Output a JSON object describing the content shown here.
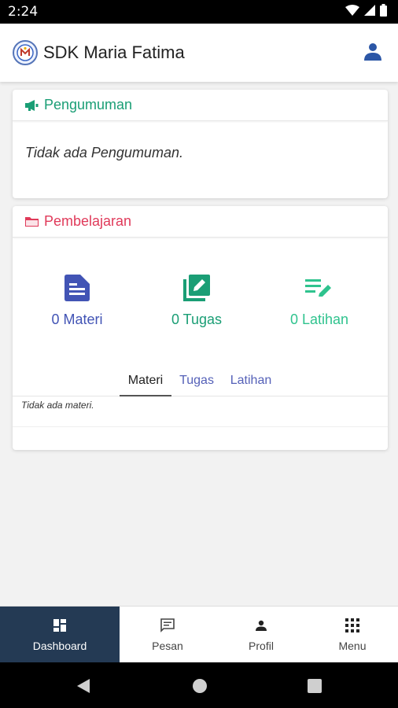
{
  "status_bar": {
    "time": "2:24"
  },
  "app_bar": {
    "title": "SDK Maria Fatima"
  },
  "announcement": {
    "title": "Pengumuman",
    "empty_text": "Tidak ada Pengumuman.",
    "accent": "#1a9e75"
  },
  "learning": {
    "title": "Pembelajaran",
    "accent": "#e03a5a",
    "stats": [
      {
        "label": "0 Materi",
        "icon": "document-icon",
        "color": "#4254b5"
      },
      {
        "label": "0 Tugas",
        "icon": "edit-box-icon",
        "color": "#1a9e75"
      },
      {
        "label": "0 Latihan",
        "icon": "list-edit-icon",
        "color": "#2fc38e"
      }
    ],
    "tabs": [
      {
        "label": "Materi",
        "active": true
      },
      {
        "label": "Tugas",
        "active": false
      },
      {
        "label": "Latihan",
        "active": false
      }
    ],
    "empty_text": "Tidak ada materi."
  },
  "bottom_nav": [
    {
      "label": "Dashboard",
      "icon": "dashboard-icon",
      "active": true
    },
    {
      "label": "Pesan",
      "icon": "message-icon",
      "active": false
    },
    {
      "label": "Profil",
      "icon": "person-icon",
      "active": false
    },
    {
      "label": "Menu",
      "icon": "grid-icon",
      "active": false
    }
  ],
  "colors": {
    "nav_active_bg": "#243a54",
    "tab_link": "#5561b8"
  }
}
